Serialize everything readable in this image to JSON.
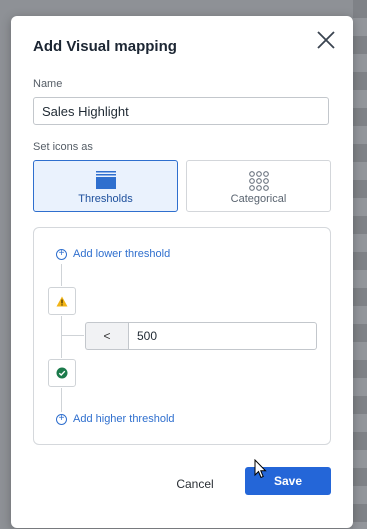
{
  "dialog": {
    "title": "Add Visual mapping",
    "name_label": "Name",
    "name_value": "Sales Highlight",
    "icons_label": "Set icons as",
    "options": [
      {
        "label": "Thresholds",
        "icon": "thresholds-icon",
        "selected": true
      },
      {
        "label": "Categorical",
        "icon": "categorical-grid-icon",
        "selected": false
      }
    ],
    "thresholds": {
      "add_lower": "Add lower threshold",
      "add_higher": "Add higher threshold",
      "upper_status_icon": "warning-icon",
      "lower_status_icon": "check-circle-icon",
      "operator": "<",
      "value": "500"
    },
    "cancel_label": "Cancel",
    "save_label": "Save"
  },
  "colors": {
    "accent": "#2466d8",
    "selected_bg": "#eaf2fd",
    "warning": "#f2b416",
    "success": "#1b7a4b"
  }
}
